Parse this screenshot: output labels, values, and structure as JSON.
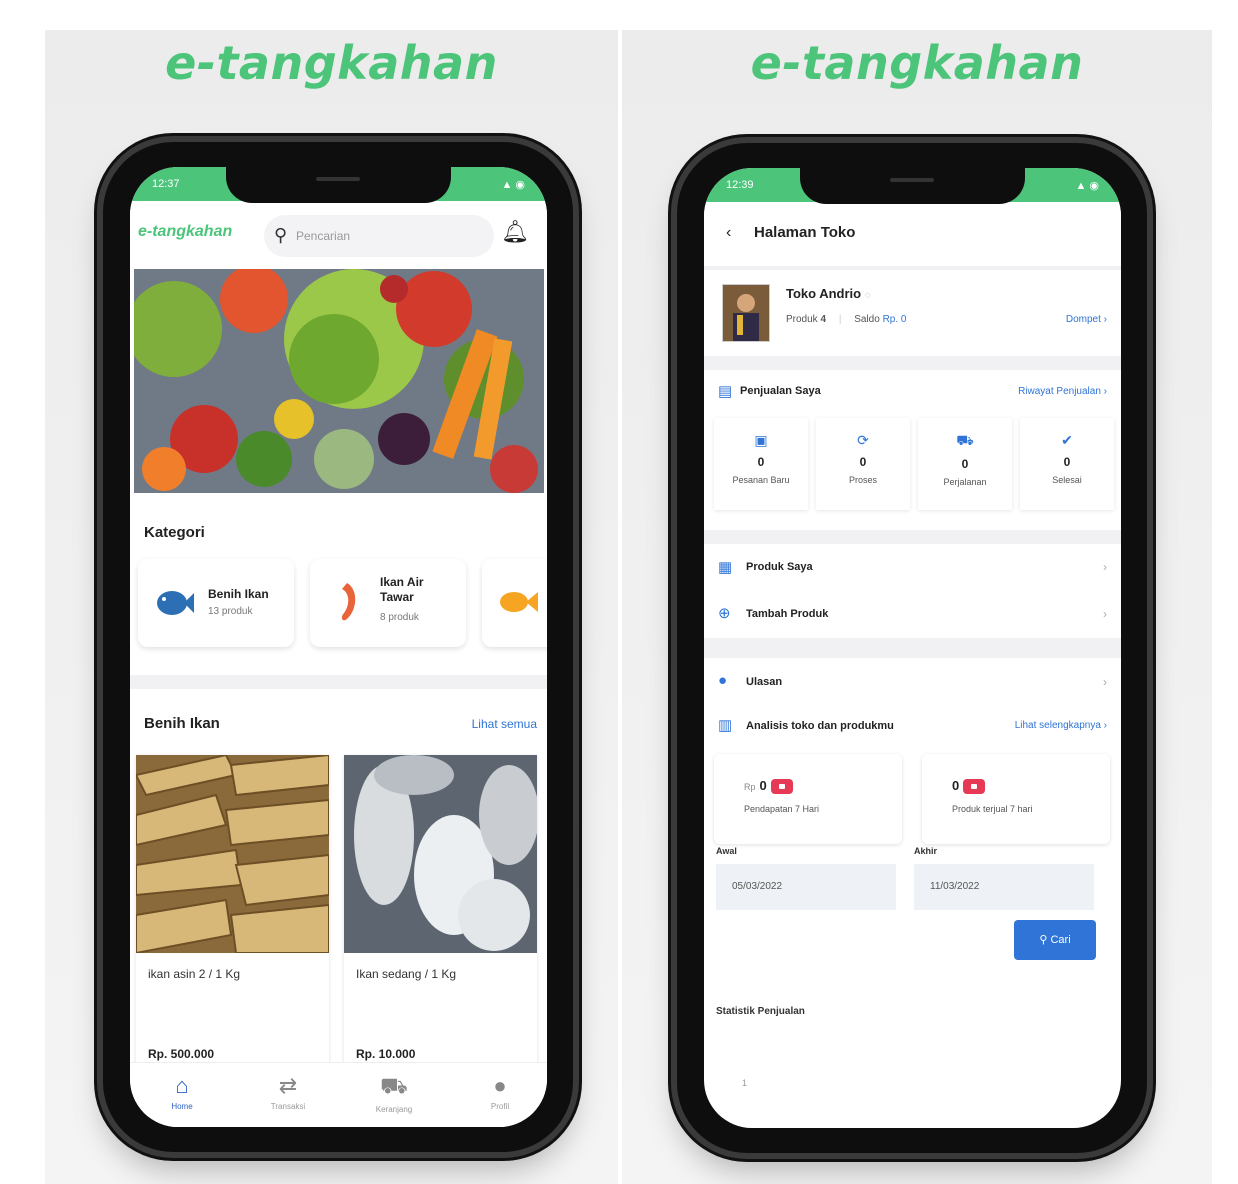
{
  "brand": "e-tangkahan",
  "left_phone": {
    "status": {
      "time": "12:37",
      "signal": "▲ ◉"
    },
    "header": {
      "logo": "e-tangkahan",
      "search_placeholder": "Pencarian"
    },
    "kategori_title": "Kategori",
    "categories": [
      {
        "name_line1": "Benih Ikan",
        "name_line2": "",
        "count": "13 produk"
      },
      {
        "name_line1": "Ikan Air",
        "name_line2": "Tawar",
        "count": "8 produk"
      }
    ],
    "benih_title": "Benih Ikan",
    "see_all": "Lihat semua",
    "products": [
      {
        "name": "ikan asin 2 / 1 Kg",
        "price": "Rp. 500.000"
      },
      {
        "name": "Ikan sedang / 1 Kg",
        "price": "Rp. 10.000"
      }
    ],
    "nav": [
      {
        "label": "Home",
        "icon": "home-icon"
      },
      {
        "label": "Transaksi",
        "icon": "transfer-icon"
      },
      {
        "label": "Keranjang",
        "icon": "cart-icon"
      },
      {
        "label": "Profil",
        "icon": "user-icon"
      }
    ],
    "colors": {
      "accent": "#4cc47a",
      "active": "#2a61c7"
    }
  },
  "right_phone": {
    "status": {
      "time": "12:39",
      "signal": "▲ ◉"
    },
    "title": "Halaman Toko",
    "shop": {
      "name": "Toko Andrio",
      "produk_label": "Produk",
      "produk_count": "4",
      "saldo_label": "Saldo",
      "saldo_value": "Rp. 0",
      "dompet": "Dompet"
    },
    "penjualan": {
      "title": "Penjualan Saya",
      "history": "Riwayat Penjualan"
    },
    "stats": [
      {
        "value": "0",
        "label": "Pesanan Baru"
      },
      {
        "value": "0",
        "label": "Proses"
      },
      {
        "value": "0",
        "label": "Perjalanan"
      },
      {
        "value": "0",
        "label": "Selesai"
      }
    ],
    "menu": {
      "produk_saya": "Produk Saya",
      "tambah_produk": "Tambah Produk",
      "ulasan": "Ulasan"
    },
    "analisis": {
      "title": "Analisis toko dan produkmu",
      "more": "Lihat selengkapnya"
    },
    "analytics": [
      {
        "currency": "Rp",
        "value": "0",
        "label": "Pendapatan 7 Hari"
      },
      {
        "currency": "",
        "value": "0",
        "label": "Produk terjual 7 hari"
      }
    ],
    "dates": {
      "awal_label": "Awal",
      "awal_value": "05/03/2022",
      "akhir_label": "Akhir",
      "akhir_value": "11/03/2022"
    },
    "cari": "Cari",
    "statistik": "Statistik Penjualan",
    "axis_tick": "1"
  }
}
